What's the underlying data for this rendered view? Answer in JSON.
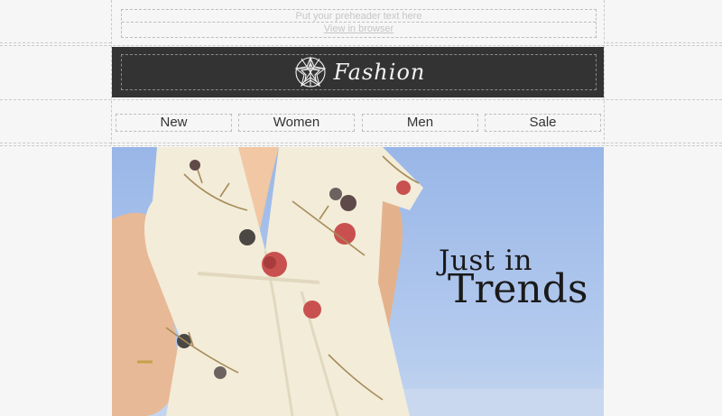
{
  "preheader": {
    "text": "Put your preheader text here",
    "browser_link": "View in browser"
  },
  "logo": {
    "brand_name": "Fashion",
    "icon": "star-flower-logo-icon"
  },
  "nav": {
    "items": [
      {
        "label": "New"
      },
      {
        "label": "Women"
      },
      {
        "label": "Men"
      },
      {
        "label": "Sale"
      }
    ]
  },
  "hero": {
    "headline_line1": "Just in",
    "headline_line2": "Trends"
  },
  "colors": {
    "page_background": "#f6f6f6",
    "logo_bar": "#333333",
    "sky": "#aac3ec",
    "headline": "#1a1a1a"
  }
}
